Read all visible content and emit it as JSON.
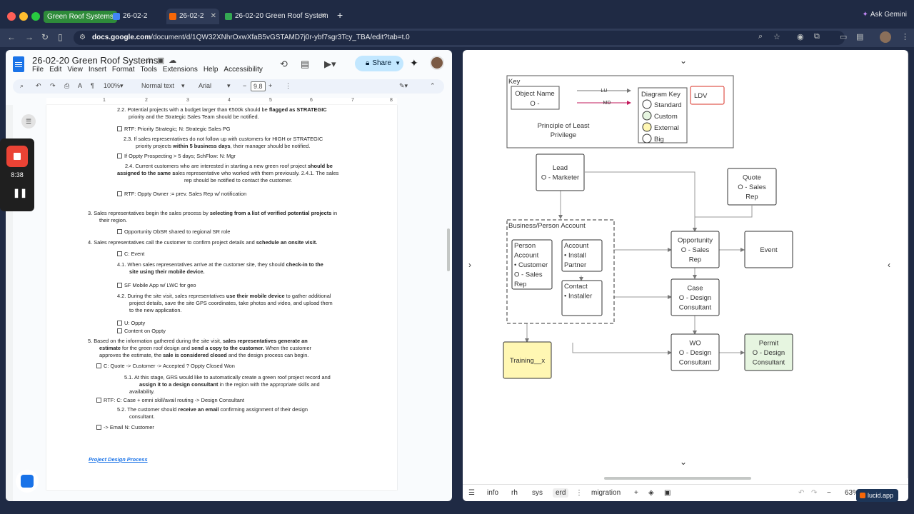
{
  "browser": {
    "tab_group": "Green Roof Systems",
    "tabs": [
      {
        "label": "26-02-2",
        "icon": "docs-icon",
        "color": "#4285f4"
      },
      {
        "label": "26-02-2",
        "icon": "lucid-icon",
        "color": "#f76707"
      },
      {
        "label": "26-02-20 Green Roof System",
        "icon": "sheets-icon",
        "color": "#34a853"
      }
    ],
    "ask_gemini": "Ask Gemini",
    "url_host": "docs.google.com",
    "url_path": "/document/d/1QW32XNhrOxwXfaB5vGSTAMD7j0r-ybf7sgr3Tcy_TBA/edit?tab=t.0"
  },
  "docs": {
    "title": "26-02-20 Green Roof Systems",
    "menu": [
      "File",
      "Edit",
      "View",
      "Insert",
      "Format",
      "Tools",
      "Extensions",
      "Help",
      "Accessibility"
    ],
    "share_label": "Share",
    "toolbar": {
      "zoom": "100%",
      "style": "Normal text",
      "font": "Arial",
      "font_size": "9.8"
    },
    "ruler": [
      "1",
      "2",
      "3",
      "4",
      "5",
      "6",
      "7",
      "8"
    ],
    "lines": [
      {
        "kind": "text",
        "html": "2.2. Potential projects with a budget larger than €500k should be <b>flagged as STRATEGIC</b>"
      },
      {
        "kind": "text",
        "html": "priority and the Strategic Sales Team should be notified."
      },
      {
        "kind": "cb",
        "html": "RTF: Priority Strategic; N: Strategic Sales PG"
      },
      {
        "kind": "text",
        "html": "2.3. If sales representatives do not follow up with customers for HIGH or STRATEGIC"
      },
      {
        "kind": "text",
        "html": "priority projects <b>within 5 business days</b>, their manager should be notified."
      },
      {
        "kind": "cb",
        "html": "If Oppty Prospecting &gt; 5 days; SchFlow: N: Mgr"
      },
      {
        "kind": "text",
        "html": "2.4. Current customers who are interested in starting a new green roof project <b>should be</b>"
      },
      {
        "kind": "text",
        "html": "<b>assigned to the same s</b>ales representative who worked with them previously. 2.4.1. The sales"
      },
      {
        "kind": "text",
        "html": "rep should be notified to contact the customer."
      },
      {
        "kind": "cb",
        "html": "RTF: Oppty Owner := prev. Sales Rep w/ notification"
      },
      {
        "kind": "text",
        "html": "3. Sales representatives begin the sales process by <b>selecting from a list of verified potential projects</b>  in"
      },
      {
        "kind": "text",
        "html": "their region."
      },
      {
        "kind": "cb",
        "html": "Opportunity ObSR shared to regional SR role"
      },
      {
        "kind": "text",
        "html": "4. Sales representatives call the customer to confirm project details and <b>schedule an onsite visit.</b>"
      },
      {
        "kind": "cb",
        "html": "C: Event"
      },
      {
        "kind": "text",
        "html": "4.1. When sales representatives arrive at the customer site, they should <b>check-in to the</b>"
      },
      {
        "kind": "text",
        "html": "<b>site using their mobile device.</b>"
      },
      {
        "kind": "cb",
        "html": "SF Mobile App w/ LWC for geo"
      },
      {
        "kind": "text",
        "html": "4.2. During the site visit, sales representatives <b>use their mobile device</b> to gather additional"
      },
      {
        "kind": "text",
        "html": "project details, save the site GPS coordinates, take photos and video, and upload  them"
      },
      {
        "kind": "text",
        "html": "to the new application."
      },
      {
        "kind": "cb",
        "html": "U: Oppty"
      },
      {
        "kind": "cb",
        "html": "Content on Oppty"
      },
      {
        "kind": "text",
        "html": "5.  Based  on  the  information  gathered  during  the  site  visit,  <b>sales  representatives  generate  an</b>"
      },
      {
        "kind": "text",
        "html": "<b>estimate</b> for the green roof design and <b>send a copy to the customer.</b> When the customer"
      },
      {
        "kind": "text",
        "html": "approves the estimate, the <b>sale is considered closed</b> and the design process can begin."
      },
      {
        "kind": "cb",
        "html": "C: Quote -&gt; Customer -&gt; Accepted ? Oppty Closed Won"
      },
      {
        "kind": "text",
        "html": "5.1. At this stage, GRS would like to automatically create a green roof project record and"
      },
      {
        "kind": "text",
        "html": "<b>assign it to a design consultant</b> in the region with the appropriate skills and"
      },
      {
        "kind": "text",
        "html": "availability."
      },
      {
        "kind": "cb",
        "html": "RTF: C: Case + omni skill/avail routing -&gt; Design Consultant"
      },
      {
        "kind": "text",
        "html": "5.2. The customer should <b>receive an email</b> confirming assignment of their design"
      },
      {
        "kind": "text",
        "html": "consultant."
      },
      {
        "kind": "cb",
        "html": "-&gt; Email N: Customer"
      }
    ],
    "link": "Project Design Process"
  },
  "recording": {
    "time": "8:38"
  },
  "lucid": {
    "key": {
      "title": "Key",
      "object_name": "Object Name",
      "object_owner": "O -",
      "lu": "LU",
      "md": "MD",
      "principle_1": "Principle of Least",
      "principle_2": "Privilege",
      "diagram_key": "Diagram Key",
      "legend": [
        {
          "label": "Standard",
          "color": "#ffffff"
        },
        {
          "label": "Custom",
          "color": "#e6f5e0"
        },
        {
          "label": "External",
          "color": "#fff7b3"
        },
        {
          "label": "Big",
          "color": "#ffffff"
        }
      ],
      "ldv": "LDV"
    },
    "lead": [
      "Lead",
      "O - Marketer"
    ],
    "quote": [
      "Quote",
      "O - Sales",
      "Rep"
    ],
    "container": "Business/Person Account",
    "person_account": [
      "Person",
      "Account",
      "• Customer",
      "O - Sales",
      "Rep"
    ],
    "account": [
      "Account",
      "• Install",
      "Partner"
    ],
    "contact": [
      "Contact",
      "• Installer"
    ],
    "opportunity": [
      "Opportunity",
      "O - Sales",
      "Rep"
    ],
    "event": [
      "Event"
    ],
    "case": [
      "Case",
      "O - Design",
      "Consultant"
    ],
    "wo": [
      "WO",
      "O - Design",
      "Consultant"
    ],
    "permit": [
      "Permit",
      "O - Design",
      "Consultant"
    ],
    "training": [
      "Training__x"
    ],
    "colors": {
      "custom": "#e6f5e0",
      "external": "#fff7b3",
      "ldv": "#d93025",
      "md_arrow": "#c2185b"
    },
    "bottom_tabs": [
      "info",
      "rh",
      "sys",
      "erd",
      "migration"
    ],
    "active_tab": "erd",
    "zoom": "63%",
    "brand": "lucid.app"
  }
}
